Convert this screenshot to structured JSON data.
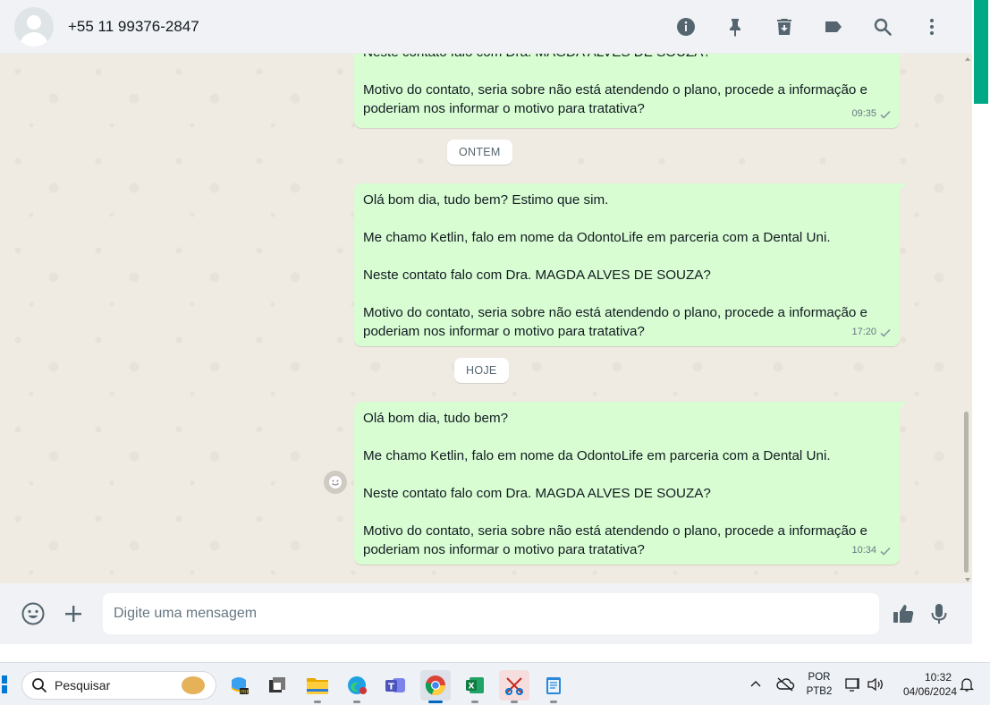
{
  "header": {
    "contact_name": "+55 11 99376-2847",
    "actions": [
      "info-icon",
      "pin-icon",
      "delete-icon",
      "label-icon",
      "search-icon",
      "menu-icon"
    ]
  },
  "messages": [
    {
      "paragraphs": [
        "Neste contato falo com Dra. MAGDA ALVES DE SOUZA?",
        "Motivo do contato, seria sobre não está atendendo o plano, procede a informação e poderiam nos informar o motivo para tratativa?"
      ],
      "time": "09:35",
      "status": "sent"
    },
    {
      "date_chip": "ONTEM",
      "paragraphs": [
        "Olá bom dia, tudo bem? Estimo que sim.",
        "Me chamo Ketlin, falo em nome da OdontoLife em parceria com a Dental Uni.",
        "Neste contato falo com Dra. MAGDA ALVES DE SOUZA?",
        "Motivo do contato, seria sobre não está atendendo o plano, procede a informação e poderiam nos informar o motivo para tratativa?"
      ],
      "time": "17:20",
      "status": "sent"
    },
    {
      "date_chip": "HOJE",
      "paragraphs": [
        "Olá bom dia, tudo bem?",
        "Me chamo Ketlin, falo em nome da OdontoLife em parceria com a Dental Uni.",
        "Neste contato falo com Dra. MAGDA ALVES DE SOUZA?",
        "Motivo do contato, seria sobre não está atendendo o plano, procede a informação e poderiam nos informar o motivo para tratativa?"
      ],
      "time": "10:34",
      "status": "sent"
    }
  ],
  "composer": {
    "placeholder": "Digite uma mensagem",
    "value": ""
  },
  "taskbar": {
    "search_label": "Pesquisar",
    "apps": [
      "copilot-icon",
      "task-view-icon",
      "file-explorer-icon",
      "edge-icon",
      "teams-icon",
      "chrome-icon",
      "excel-icon",
      "snipping-tool-icon",
      "notepad-icon"
    ],
    "language_line1": "POR",
    "language_line2": "PTB2",
    "time": "10:32",
    "date": "04/06/2024"
  },
  "colors": {
    "outgoing_bubble": "#d9fdd3",
    "accent": "#00a884",
    "chat_background": "#efeae2",
    "header_background": "#f0f2f5"
  }
}
